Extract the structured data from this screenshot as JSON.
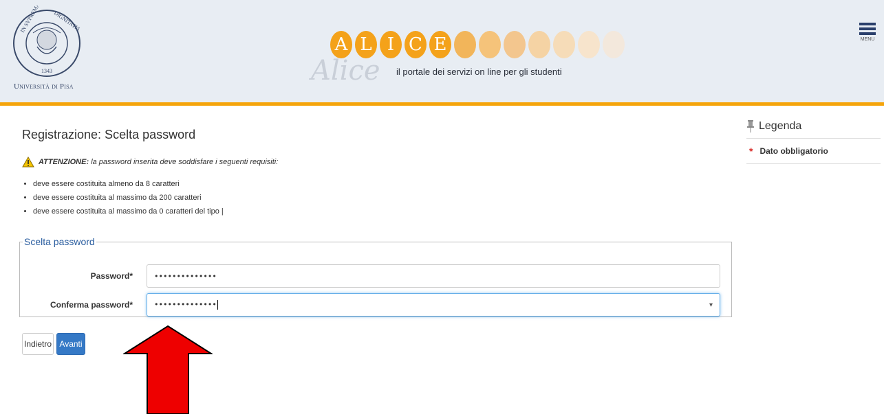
{
  "header": {
    "university_name": "Università di Pisa",
    "seal_text": "IN SUPREMAE DIGNITATIS 1343",
    "banner_letters": [
      "A",
      "L",
      "I",
      "C",
      "E"
    ],
    "banner_script": "Alice",
    "tagline": "il portale dei servizi on line per gli studenti",
    "menu_label": "MENU",
    "accent_color": "#f5a40a"
  },
  "page": {
    "title": "Registrazione: Scelta password",
    "warning_label": "ATTENZIONE:",
    "warning_text": "la password inserita deve soddisfare i seguenti requisiti:",
    "requirements": [
      "deve essere costituita almeno da 8 caratteri",
      "deve essere costituita al massimo da 200 caratteri",
      "deve essere costituita al massimo da 0 caratteri del tipo |"
    ]
  },
  "form": {
    "legend": "Scelta password",
    "password_label": "Password*",
    "password_value": "••••••••••••••",
    "confirm_label": "Conferma password*",
    "confirm_value": "••••••••••••••",
    "toggle_icon": "eye-icon"
  },
  "buttons": {
    "back": "Indietro",
    "next": "Avanti",
    "primary_color": "#3579c6"
  },
  "sidebar": {
    "title": "Legenda",
    "items": [
      {
        "symbol": "*",
        "label": "Dato obbligatorio"
      }
    ]
  },
  "annotation": {
    "shape": "red-arrow-up",
    "color": "#ee0000"
  }
}
